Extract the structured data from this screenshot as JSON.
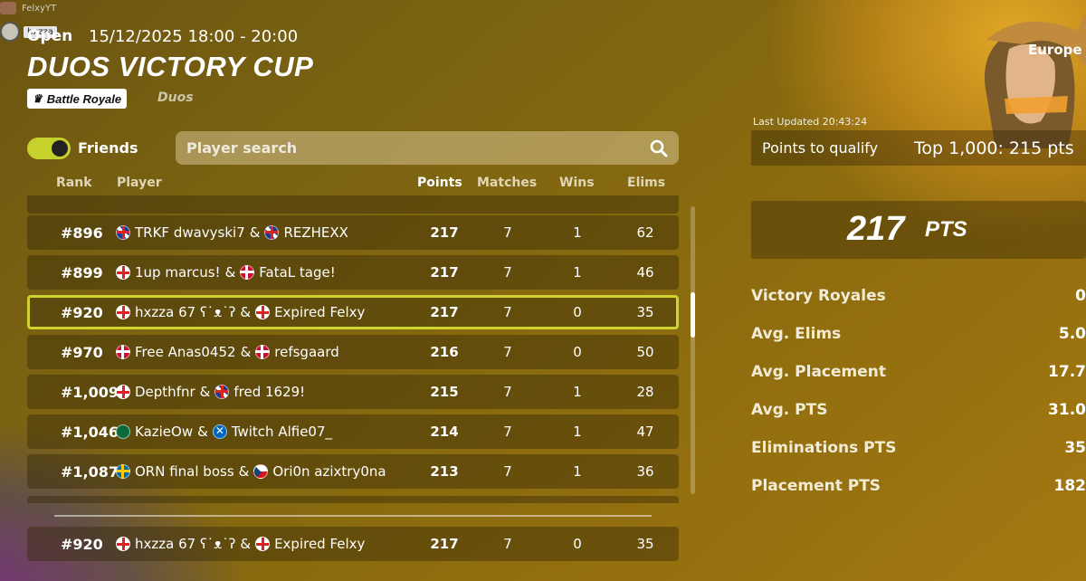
{
  "overlay": {
    "streamer_name": "FelxyYT",
    "viewer_name": "hxzza"
  },
  "event": {
    "status": "Open",
    "time": "15/12/2025 18:00 - 20:00",
    "title": "DUOS VICTORY CUP",
    "mode": "Battle Royale",
    "type": "Duos",
    "region": "Europe"
  },
  "filters": {
    "friends_label": "Friends",
    "friends_on": true,
    "search_placeholder": "Player search"
  },
  "table": {
    "headers": [
      "Rank",
      "Player",
      "Points",
      "Matches",
      "Wins",
      "Elims"
    ],
    "rows": [
      {
        "rank": "#896",
        "p1_flag": "uk",
        "p1": "TRKF dwavyski7",
        "sep": "&",
        "p2_flag": "uk",
        "p2": "REZHEXX",
        "points": "217",
        "matches": "7",
        "wins": "1",
        "elims": "62"
      },
      {
        "rank": "#899",
        "p1_flag": "eng",
        "p1": "1up marcus!",
        "sep": "&",
        "p2_flag": "dk",
        "p2": "FataL tage!",
        "points": "217",
        "matches": "7",
        "wins": "1",
        "elims": "46"
      },
      {
        "rank": "#920",
        "p1_flag": "eng",
        "p1": "hxzza 67 ʕ˙ᴥ˙ʔ",
        "sep": "&",
        "p2_flag": "eng",
        "p2": "Expired Felxy",
        "points": "217",
        "matches": "7",
        "wins": "0",
        "elims": "35"
      },
      {
        "rank": "#970",
        "p1_flag": "dk",
        "p1": "Free Anas0452",
        "sep": "&",
        "p2_flag": "dk",
        "p2": "refsgaard",
        "points": "216",
        "matches": "7",
        "wins": "0",
        "elims": "50"
      },
      {
        "rank": "#1,009",
        "p1_flag": "eng",
        "p1": "Depthfnr",
        "sep": "&",
        "p2_flag": "uk",
        "p2": "fred 1629!",
        "points": "215",
        "matches": "7",
        "wins": "1",
        "elims": "28"
      },
      {
        "rank": "#1,046",
        "p1_flag": "sa",
        "p1": "KazieOw",
        "sep": "&",
        "p2_flag": "sc",
        "p2": "Twitch Alfie07_",
        "points": "214",
        "matches": "7",
        "wins": "1",
        "elims": "47"
      },
      {
        "rank": "#1,087",
        "p1_flag": "se",
        "p1": "ORN final boss",
        "sep": "&",
        "p2_flag": "cz",
        "p2": "Ori0n azixtry0na",
        "points": "213",
        "matches": "7",
        "wins": "1",
        "elims": "36"
      }
    ],
    "my_row": {
      "rank": "#920",
      "p1_flag": "eng",
      "p1": "hxzza 67 ʕ˙ᴥ˙ʔ",
      "sep": "&",
      "p2_flag": "eng",
      "p2": "Expired Felxy",
      "points": "217",
      "matches": "7",
      "wins": "0",
      "elims": "35"
    }
  },
  "summary": {
    "last_updated": "Last Updated 20:43:24",
    "qualify_label": "Points to qualify",
    "qualify_value": "Top 1,000: 215 pts",
    "total_points": "217",
    "total_unit": "PTS",
    "stats": [
      {
        "label": "Victory Royales",
        "value": "0"
      },
      {
        "label": "Avg. Elims",
        "value": "5.0"
      },
      {
        "label": "Avg. Placement",
        "value": "17.7"
      },
      {
        "label": "Avg. PTS",
        "value": "31.0"
      },
      {
        "label": "Eliminations PTS",
        "value": "35"
      },
      {
        "label": "Placement PTS",
        "value": "182"
      }
    ]
  },
  "colors": {
    "accent": "#cfd32e",
    "row_bg": "#3a2c08"
  }
}
